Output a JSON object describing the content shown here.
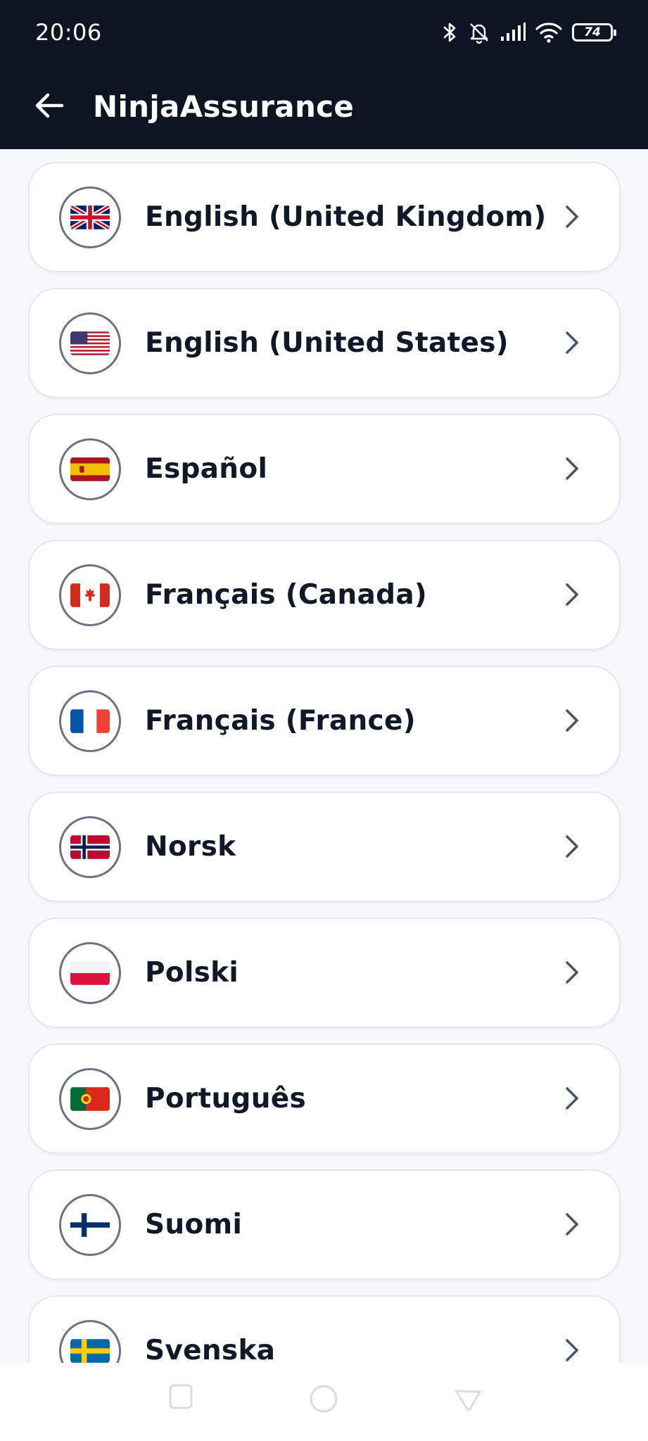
{
  "status_bar": {
    "time": "20:06",
    "battery": "74",
    "icons": [
      "bluetooth-icon",
      "bell-muted-icon",
      "signal-icon",
      "wifi-icon",
      "battery-icon"
    ]
  },
  "app_bar": {
    "title": "NinjaAssurance",
    "back_icon": "arrow-left-icon"
  },
  "languages": [
    {
      "label": "English (United Kingdom)",
      "flag": "gb-flag-icon"
    },
    {
      "label": "English (United States)",
      "flag": "us-flag-icon"
    },
    {
      "label": "Español",
      "flag": "es-flag-icon"
    },
    {
      "label": "Français (Canada)",
      "flag": "ca-flag-icon"
    },
    {
      "label": "Français (France)",
      "flag": "fr-flag-icon"
    },
    {
      "label": "Norsk",
      "flag": "no-flag-icon"
    },
    {
      "label": "Polski",
      "flag": "pl-flag-icon"
    },
    {
      "label": "Português",
      "flag": "pt-flag-icon"
    },
    {
      "label": "Suomi",
      "flag": "fi-flag-icon"
    },
    {
      "label": "Svenska",
      "flag": "se-flag-icon"
    }
  ],
  "colors": {
    "header_bg": "#0d1422",
    "page_bg": "#f6f8fb",
    "card_bg": "#ffffff",
    "text": "#111827"
  }
}
